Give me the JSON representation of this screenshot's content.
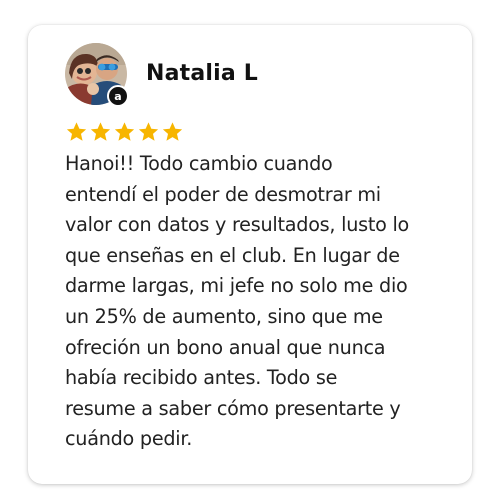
{
  "review": {
    "reviewer_name": "Natalia L",
    "badge_letter": "a",
    "rating": 5,
    "rating_max": 5,
    "star_color": "#F7B500",
    "text": "Hanoi!! Todo cambio cuando\nentendí el poder de desmotrar mi\nvalor con datos y resultados, lusto lo\nque enseñas en el club. En lugar de\ndarme largas, mi jefe no solo me dio\nun 25% de aumento, sino que me\nofreción un bono anual que nunca\nhabía recibido antes. Todo se\nresume a saber cómo presentarte y\ncuándo pedir."
  },
  "icons": {
    "avatar": "avatar-photo",
    "badge": "amazon-logo-icon",
    "star": "star-icon"
  }
}
